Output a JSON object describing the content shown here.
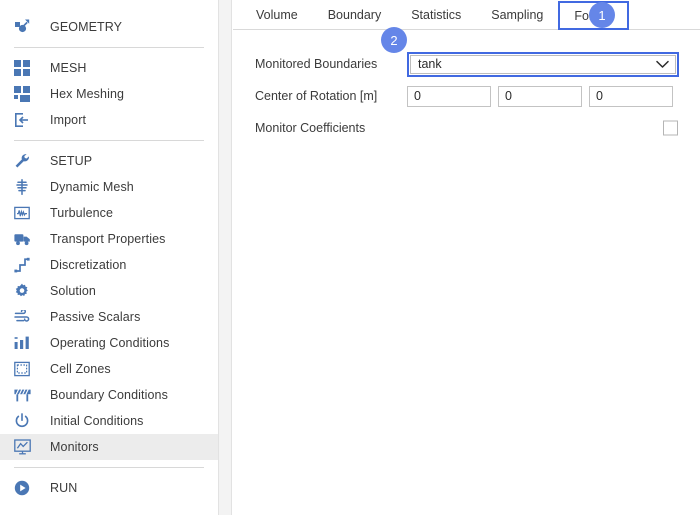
{
  "sidebar": {
    "groups": [
      {
        "items": [
          {
            "label": "GEOMETRY",
            "icon": "geometry-icon",
            "selected": false
          }
        ]
      },
      {
        "items": [
          {
            "label": "MESH",
            "icon": "mesh-icon",
            "selected": false
          },
          {
            "label": "Hex Meshing",
            "icon": "hex-meshing-icon",
            "selected": false
          },
          {
            "label": "Import",
            "icon": "import-icon",
            "selected": false
          }
        ]
      },
      {
        "items": [
          {
            "label": "SETUP",
            "icon": "wrench-icon",
            "selected": false
          },
          {
            "label": "Dynamic Mesh",
            "icon": "dynamic-mesh-icon",
            "selected": false
          },
          {
            "label": "Turbulence",
            "icon": "turbulence-icon",
            "selected": false
          },
          {
            "label": "Transport Properties",
            "icon": "truck-icon",
            "selected": false
          },
          {
            "label": "Discretization",
            "icon": "discretization-icon",
            "selected": false
          },
          {
            "label": "Solution",
            "icon": "gear-icon",
            "selected": false
          },
          {
            "label": "Passive Scalars",
            "icon": "wind-icon",
            "selected": false
          },
          {
            "label": "Operating Conditions",
            "icon": "bar-chart-icon",
            "selected": false
          },
          {
            "label": "Cell Zones",
            "icon": "cell-zones-icon",
            "selected": false
          },
          {
            "label": "Boundary Conditions",
            "icon": "barrier-icon",
            "selected": false
          },
          {
            "label": "Initial Conditions",
            "icon": "power-icon",
            "selected": false
          },
          {
            "label": "Monitors",
            "icon": "monitor-chart-icon",
            "selected": true
          }
        ]
      },
      {
        "items": [
          {
            "label": "RUN",
            "icon": "play-icon",
            "selected": false
          }
        ]
      }
    ]
  },
  "panel": {
    "tabs": [
      {
        "label": "Volume",
        "active": false
      },
      {
        "label": "Boundary",
        "active": false
      },
      {
        "label": "Statistics",
        "active": false
      },
      {
        "label": "Sampling",
        "active": false
      },
      {
        "label": "Forces",
        "active": true
      }
    ],
    "form": {
      "monitored_boundaries": {
        "label": "Monitored Boundaries",
        "value": "tank",
        "caret_icon": "chevron-down-icon"
      },
      "center_of_rotation": {
        "label": "Center of Rotation [m]",
        "values": [
          "0",
          "0",
          "0"
        ]
      },
      "monitor_coefficients": {
        "label": "Monitor Coefficients",
        "checked": false
      }
    }
  },
  "callouts": [
    {
      "number": "1"
    },
    {
      "number": "2"
    }
  ],
  "colors": {
    "accent_blue": "#4169e1",
    "badge_blue": "#6586e8",
    "icon_blue": "#4a77b4",
    "selected_row": "#ececec"
  }
}
